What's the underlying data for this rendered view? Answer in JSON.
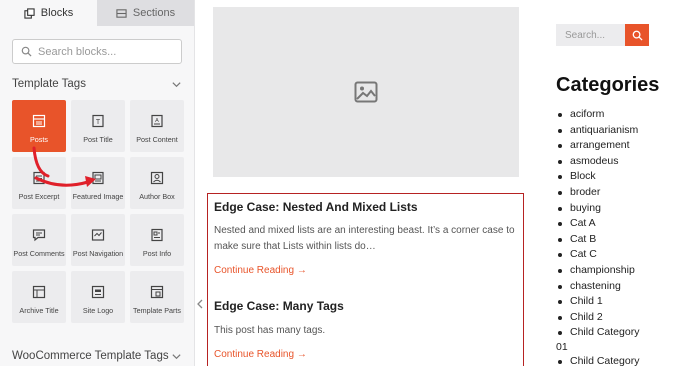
{
  "panel": {
    "tabs": [
      {
        "label": "Blocks",
        "icon": "blocks-icon"
      },
      {
        "label": "Sections",
        "icon": "sections-icon"
      }
    ],
    "search_placeholder": "Search blocks...",
    "template_tags_label": "Template Tags",
    "blocks": [
      {
        "label": "Posts",
        "icon": "posts-icon",
        "active": true
      },
      {
        "label": "Post Title",
        "icon": "post-title-icon"
      },
      {
        "label": "Post Content",
        "icon": "post-content-icon"
      },
      {
        "label": "Post Excerpt",
        "icon": "post-excerpt-icon"
      },
      {
        "label": "Featured Image",
        "icon": "featured-image-icon"
      },
      {
        "label": "Author Box",
        "icon": "author-box-icon"
      },
      {
        "label": "Post Comments",
        "icon": "post-comments-icon"
      },
      {
        "label": "Post Navigation",
        "icon": "post-navigation-icon"
      },
      {
        "label": "Post Info",
        "icon": "post-info-icon"
      },
      {
        "label": "Archive Title",
        "icon": "archive-title-icon"
      },
      {
        "label": "Site Logo",
        "icon": "site-logo-icon"
      },
      {
        "label": "Template Parts",
        "icon": "template-parts-icon"
      }
    ],
    "woo_label": "WooCommerce Template Tags"
  },
  "posts": [
    {
      "title": "Edge Case: Nested And Mixed Lists",
      "excerpt": "Nested and mixed lists are an interesting beast. It’s a corner case to make sure that Lists within lists do…",
      "link": "Continue Reading →"
    },
    {
      "title": "Edge Case: Many Tags",
      "excerpt": "This post has many tags.",
      "link": "Continue Reading →"
    }
  ],
  "sidebar": {
    "search_placeholder": "Search...",
    "categories_title": "Categories",
    "categories": [
      "aciform",
      "antiquarianism",
      "arrangement",
      "asmodeus",
      "Block",
      "broder",
      "buying",
      "Cat A",
      "Cat B",
      "Cat C",
      "championship",
      "chastening",
      "Child 1",
      "Child 2",
      "Child Category",
      "Child Category"
    ],
    "category_suffix": "01"
  },
  "colors": {
    "accent": "#e8542a",
    "selection_border": "#b62222",
    "annotation_arrow": "#e0202a"
  }
}
